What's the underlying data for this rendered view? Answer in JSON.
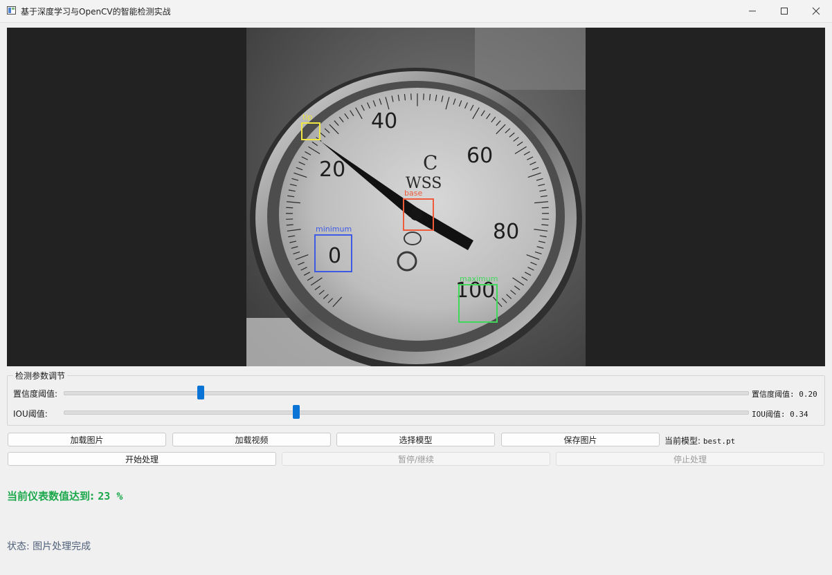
{
  "window": {
    "title": "基于深度学习与OpenCV的智能检测实战",
    "controls": {
      "minimize": "minimize-icon",
      "maximize": "maximize-icon",
      "close": "close-icon"
    }
  },
  "detections": [
    {
      "label": "tip",
      "color": "#f0e840"
    },
    {
      "label": "base",
      "color": "#ee5a3a"
    },
    {
      "label": "minimum",
      "color": "#3d5ae6"
    },
    {
      "label": "maximum",
      "color": "#40d85a"
    }
  ],
  "gauge": {
    "dial_labels": [
      "20",
      "40",
      "60",
      "80",
      "0",
      "100"
    ],
    "unit": "C",
    "brand": "WSS",
    "needle_color": "#111111"
  },
  "params": {
    "group_title": "检测参数调节",
    "confidence": {
      "label": "置信度阈值:",
      "value_text": "置信度阈值: 0.20",
      "value": 0.2
    },
    "iou": {
      "label": "IOU阈值:",
      "value_text": "IOU阈值: 0.34",
      "value": 0.34
    }
  },
  "buttons": {
    "load_image": "加载图片",
    "load_video": "加载视频",
    "select_model": "选择模型",
    "save_image": "保存图片",
    "start": "开始处理",
    "pause_resume": "暂停/继续",
    "stop": "停止处理"
  },
  "model": {
    "label": "当前模型:",
    "name": "best.pt"
  },
  "result": {
    "label": "当前仪表数值达到:",
    "value": "23 %",
    "color": "#1aa84a"
  },
  "status": {
    "text": "状态: 图片处理完成"
  },
  "colors": {
    "accent": "#0a74d6"
  }
}
